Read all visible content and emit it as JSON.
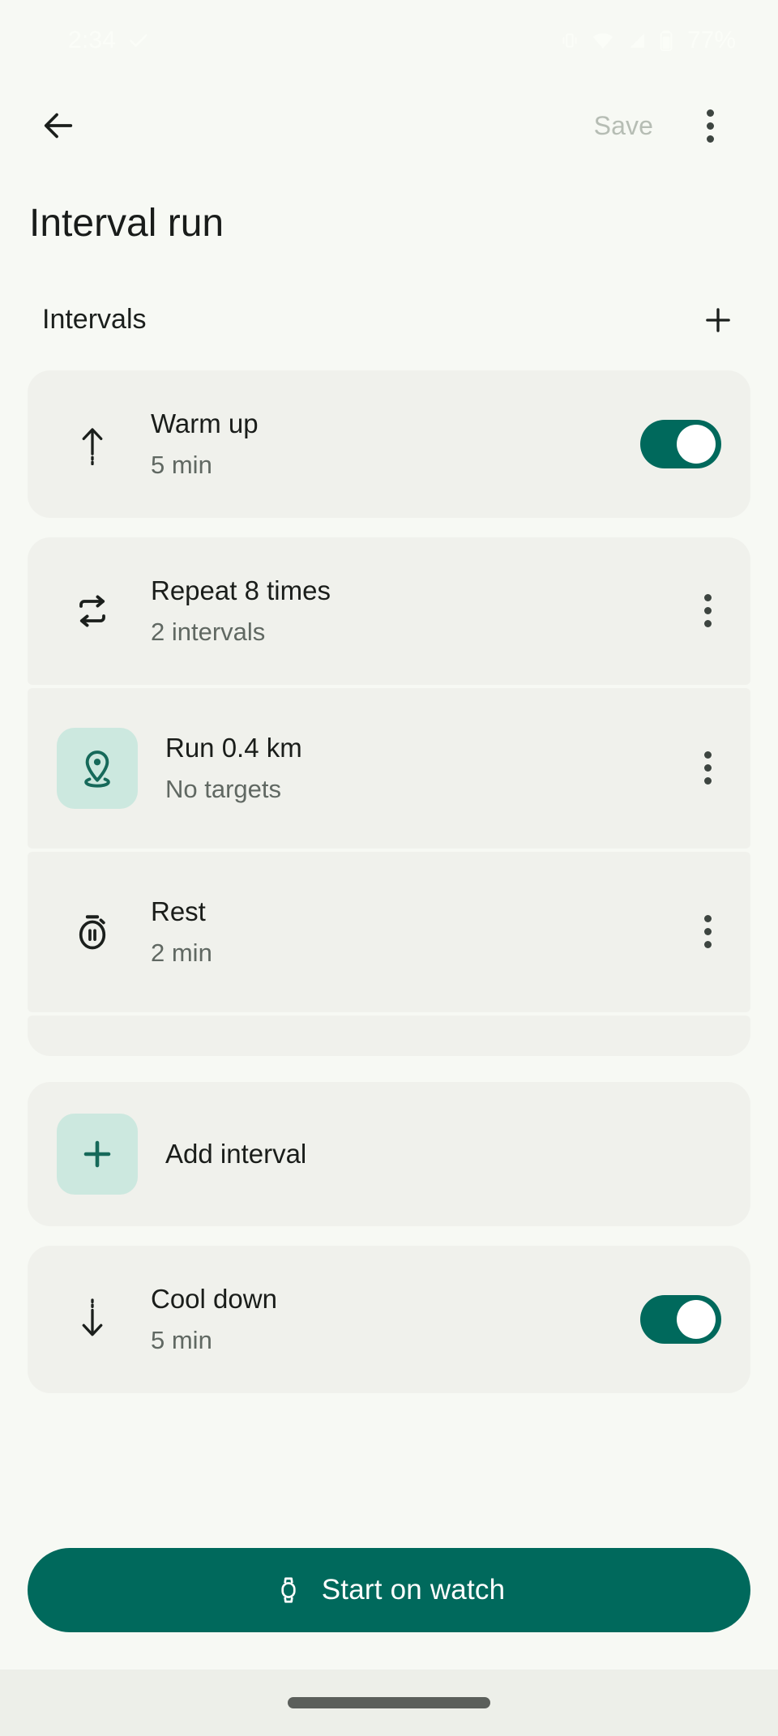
{
  "status_bar": {
    "time": "2:34",
    "check_icon": "check-icon",
    "vibrate_icon": "vibrate-icon",
    "wifi_icon": "wifi-icon",
    "signal_icon": "cell-signal-icon",
    "battery_icon": "battery-icon",
    "battery_text": "77%"
  },
  "app_bar": {
    "back_icon": "back-arrow-icon",
    "save_label": "Save",
    "save_enabled": false,
    "overflow_icon": "more-vert-icon"
  },
  "page": {
    "title": "Interval run"
  },
  "section": {
    "title": "Intervals",
    "add_icon": "plus-icon"
  },
  "intervals": [
    {
      "id": "warm-up",
      "icon": "arrow-up-dashed-icon",
      "title": "Warm up",
      "subtitle": "5 min",
      "trailing": "toggle",
      "toggle_on": true
    },
    {
      "id": "repeat",
      "icon": "repeat-icon",
      "title": "Repeat 8 times",
      "subtitle": "2 intervals",
      "trailing": "kebab"
    },
    {
      "id": "run",
      "icon": "location-pin-icon",
      "icon_tile": true,
      "title": "Run 0.4 km",
      "subtitle": "No targets",
      "trailing": "kebab"
    },
    {
      "id": "rest",
      "icon": "stopwatch-pause-icon",
      "title": "Rest",
      "subtitle": "2 min",
      "trailing": "kebab"
    }
  ],
  "add_interval": {
    "icon": "plus-icon",
    "label": "Add interval"
  },
  "cool_down": {
    "icon": "arrow-down-dashed-icon",
    "title": "Cool down",
    "subtitle": "5 min",
    "toggle_on": true
  },
  "cta": {
    "icon": "watch-icon",
    "label": "Start on watch"
  },
  "colors": {
    "page_background": "#F7F9F4",
    "card_background": "#F0F1EC",
    "accent_green": "#00695C",
    "tile_green": "#CCE8DF",
    "icon_green": "#16695A",
    "text_primary": "#1A1D1A",
    "text_secondary": "#606862",
    "text_disabled": "#B6BDB4"
  }
}
